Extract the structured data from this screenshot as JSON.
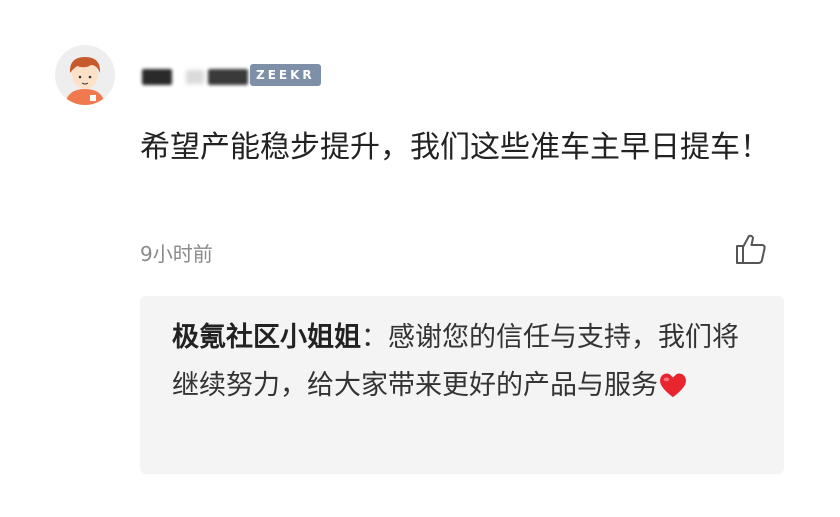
{
  "user": {
    "avatar_icon": "cartoon-avatar-icon",
    "badge": "ZEEKR",
    "badge_color": "#7e8fa8"
  },
  "comment": {
    "text": "希望产能稳步提升，我们这些准车主早日提车！",
    "time": "9小时前",
    "like_icon": "thumbs-up-icon"
  },
  "reply": {
    "author": "极氪社区小姐姐",
    "separator": "：",
    "text": "感谢您的信任与支持，我们将继续努力，给大家带来更好的产品与服务",
    "heart_icon": "red-heart-icon"
  }
}
